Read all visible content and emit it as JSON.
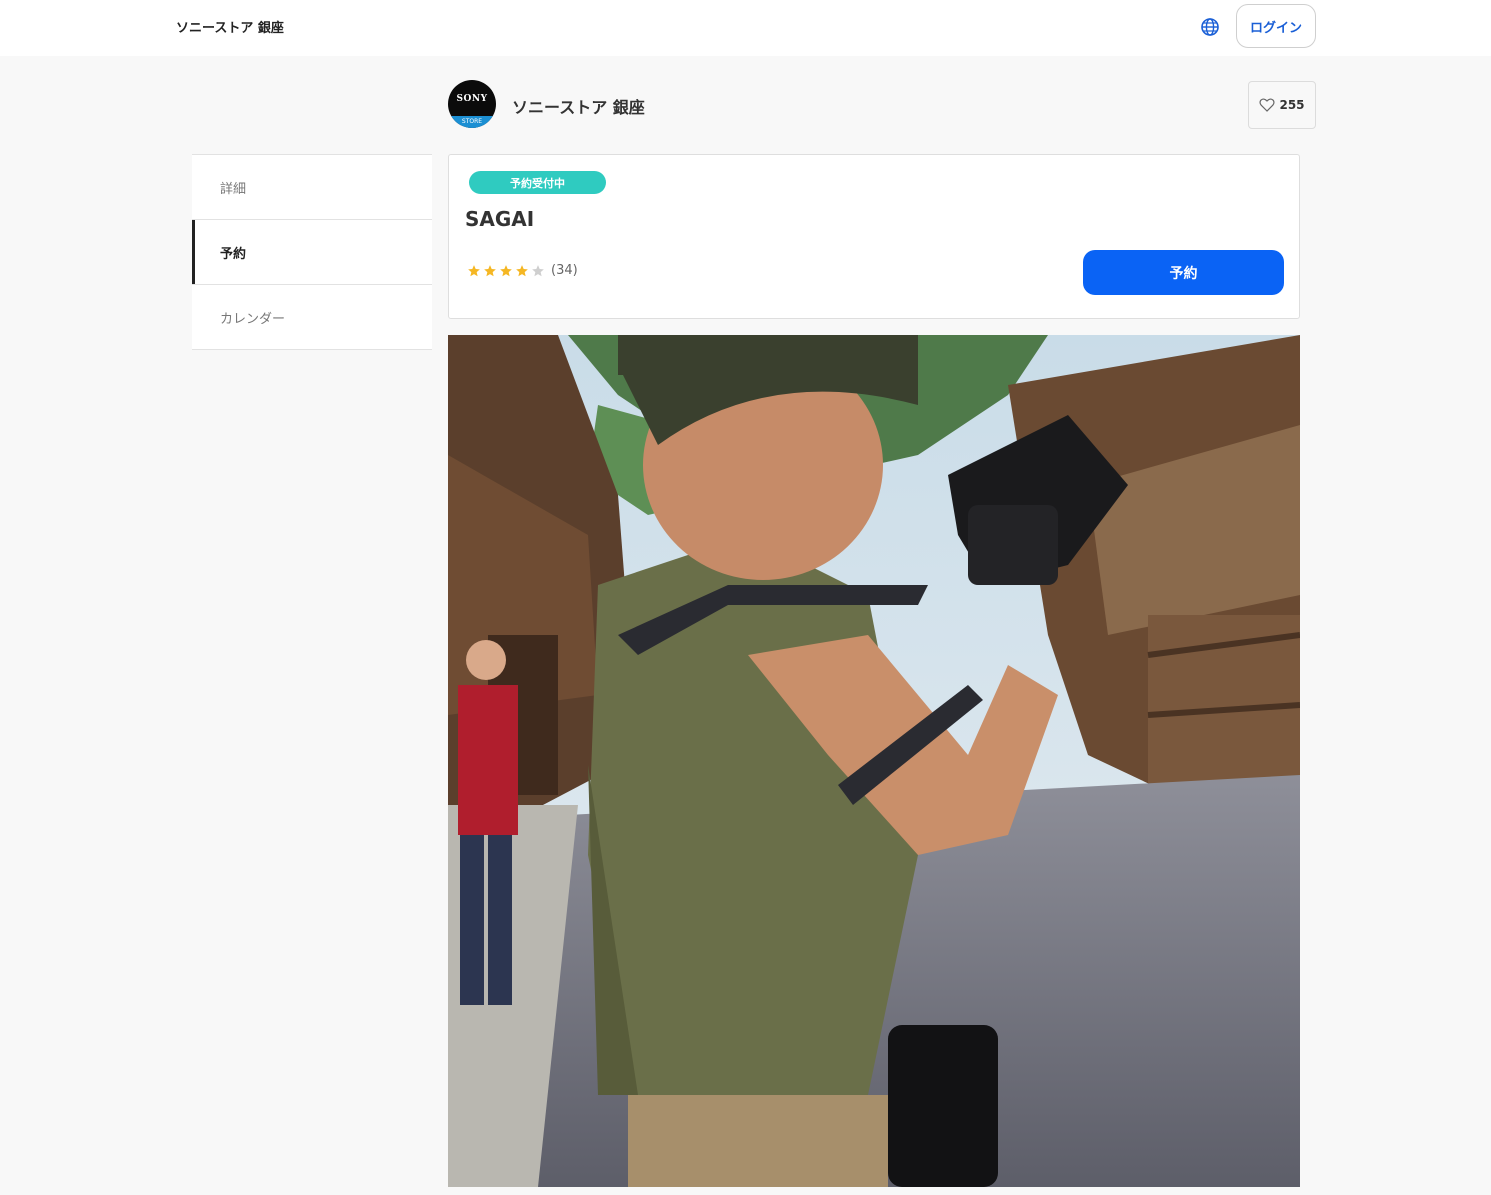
{
  "header": {
    "brand": "ソニーストア 銀座",
    "login_label": "ログイン",
    "globe_icon": "globe-icon"
  },
  "shop": {
    "name": "ソニーストア 銀座",
    "logo_top": "SONY",
    "logo_bottom": "STORE",
    "like_count": "255"
  },
  "sidenav": {
    "items": [
      {
        "label": "詳細"
      },
      {
        "label": "予約"
      },
      {
        "label": "カレンダー"
      }
    ],
    "active": "予約"
  },
  "card": {
    "badge": "予約受付中",
    "title": "SAGAI",
    "rating": 4,
    "rating_max": 5,
    "review_count": "(34)",
    "reserve_label": "予約"
  },
  "colors": {
    "accent": "#0a63f5",
    "badge": "#2fcbc0",
    "star": "#f5b724",
    "star_empty": "#cfcfcf"
  }
}
